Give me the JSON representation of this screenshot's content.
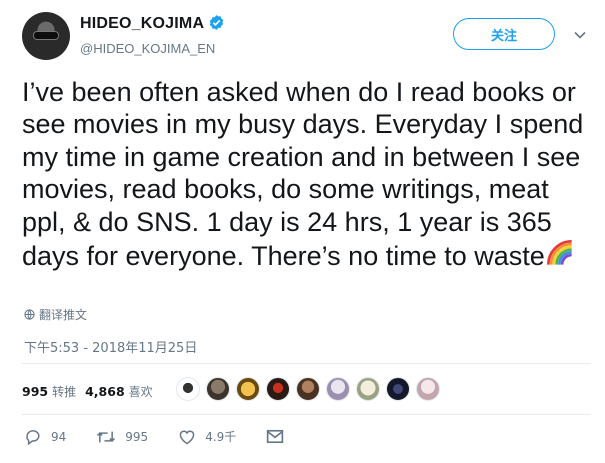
{
  "user": {
    "display_name": "HIDEO_KOJIMA",
    "handle": "@HIDEO_KOJIMA_EN",
    "verified": true,
    "follow_label": "关注"
  },
  "tweet": {
    "text": "I’ve been often asked when do I read books or see movies in my busy days. Everyday I spend my time in game creation and in between I see movies, read books, do some writings, meat ppl, & do SNS. 1 day is 24 hrs, 1 year is 365 days for everyone. There’s no time to waste",
    "emoji": "rainbow",
    "translate_label": "翻译推文",
    "timestamp": "下午5:53 - 2018年11月25日"
  },
  "stats": {
    "retweets_count": "995",
    "retweets_label": "转推",
    "likes_count": "4,868",
    "likes_label": "喜欢",
    "liker_avatars": 10
  },
  "actions": {
    "reply_count": "94",
    "retweet_count": "995",
    "like_count": "4.9千"
  },
  "colors": {
    "accent": "#1da1f2",
    "text": "#14171a",
    "muted": "#657786",
    "divider": "#e6ecf0"
  }
}
